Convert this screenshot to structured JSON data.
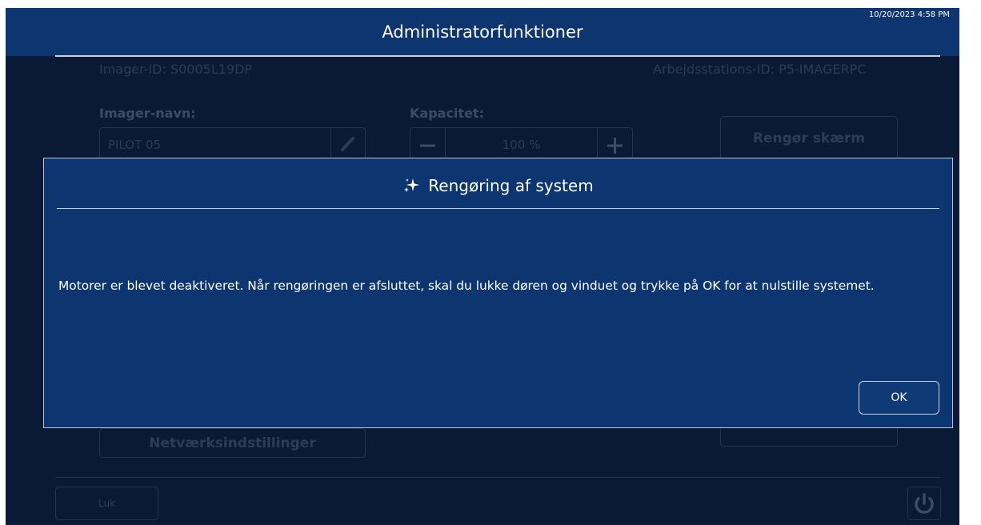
{
  "header": {
    "title": "Administratorfunktioner",
    "datetime": "10/20/2023 4:58 PM"
  },
  "background": {
    "imager_id": "Imager-ID: S0005L19DP",
    "workstation_id": "Arbejdsstations-ID: P5-IMAGERPC",
    "imager_name_label": "Imager-navn:",
    "imager_name_value": "PILOT 05",
    "capacity_label": "Kapacitet:",
    "capacity_value": "100 %",
    "clean_screen_button": "Rengør skærm",
    "network_settings_button": "Netværksindstillinger",
    "close_button": "Luk"
  },
  "dialog": {
    "title": "Rengøring af system",
    "message": "Motorer er blevet deaktiveret. Når rengøringen er afsluttet, skal du lukke døren og vinduet og trykke på OK for at nulstille systemet.",
    "ok_label": "OK"
  },
  "colors": {
    "panel_blue": "#0d3570",
    "screen_bg": "#0a1a36"
  }
}
